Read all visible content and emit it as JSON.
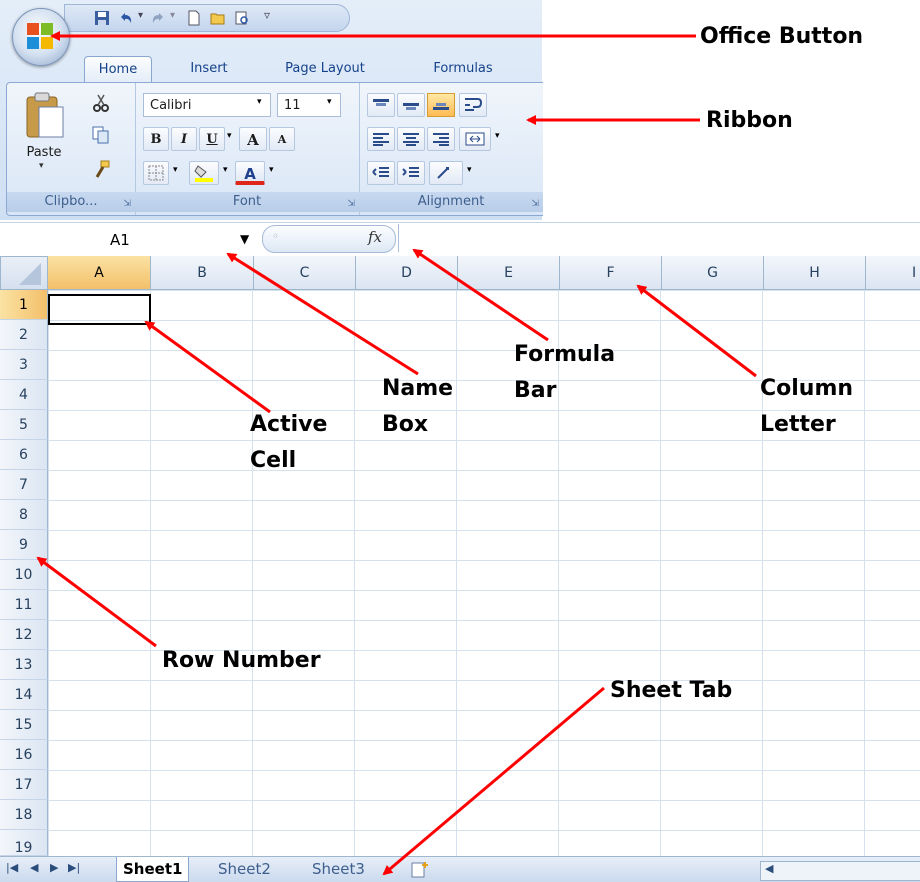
{
  "quick_access": {
    "icons": [
      "save-icon",
      "undo-icon",
      "redo-icon",
      "new-icon",
      "open-icon",
      "print-preview-icon"
    ]
  },
  "ribbon": {
    "tabs": [
      {
        "label": "Home",
        "active": true
      },
      {
        "label": "Insert",
        "active": false
      },
      {
        "label": "Page Layout",
        "active": false
      },
      {
        "label": "Formulas",
        "active": false
      }
    ],
    "groups": {
      "clipboard": {
        "label": "Clipbo...",
        "paste_label": "Paste"
      },
      "font": {
        "label": "Font",
        "font_name": "Calibri",
        "font_size": "11",
        "bold": "B",
        "italic": "I",
        "underline": "U",
        "grow": "A",
        "shrink": "A",
        "color_a": "A"
      },
      "alignment": {
        "label": "Alignment"
      }
    }
  },
  "formula_bar": {
    "name_box_value": "A1",
    "fx_label": "fx",
    "formula_value": ""
  },
  "grid": {
    "columns": [
      "A",
      "B",
      "C",
      "D",
      "E",
      "F",
      "G",
      "H",
      "I"
    ],
    "rows": [
      "1",
      "2",
      "3",
      "4",
      "5",
      "6",
      "7",
      "8",
      "9",
      "10",
      "11",
      "12",
      "13",
      "14",
      "15",
      "16",
      "17",
      "18",
      "19"
    ],
    "active_cell": "A1"
  },
  "sheet_tabs": {
    "tabs": [
      "Sheet1",
      "Sheet2",
      "Sheet3"
    ],
    "active": "Sheet1"
  },
  "annotations": {
    "office_button": "Office Button",
    "ribbon": "Ribbon",
    "formula_bar_1": "Formula",
    "formula_bar_2": "Bar",
    "name_box_1": "Name",
    "name_box_2": "Box",
    "column_letter_1": "Column",
    "column_letter_2": "Letter",
    "active_cell_1": "Active",
    "active_cell_2": "Cell",
    "row_number": "Row Number",
    "sheet_tab": "Sheet Tab"
  },
  "colors": {
    "arrow": "#ff0000",
    "selected_header": "#f3c06a",
    "ribbon_blue": "#d9e6f6",
    "label_text": "#15428b"
  }
}
